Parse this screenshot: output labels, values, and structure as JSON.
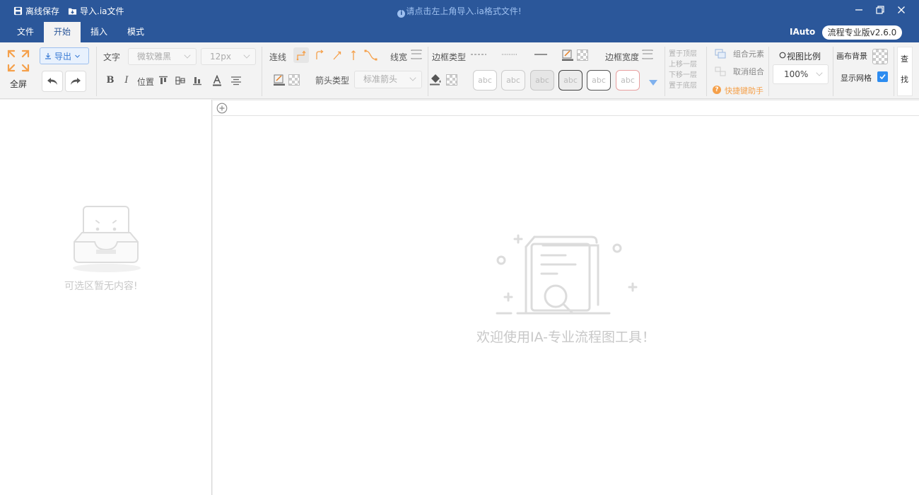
{
  "titlebar": {
    "save_label": "离线保存",
    "import_label": "导入.ia文件",
    "notice": "请点击左上角导入.ia格式文件!"
  },
  "menu": {
    "tabs": [
      {
        "label": "文件"
      },
      {
        "label": "开始",
        "active": true
      },
      {
        "label": "插入"
      },
      {
        "label": "模式"
      }
    ],
    "brand": "IAuto",
    "version": "流程专业版v2.6.0"
  },
  "ribbon": {
    "fullscreen_label": "全屏",
    "export_label": "导出",
    "text_label": "文字",
    "font_family": "微软雅黑",
    "font_size": "12px",
    "position_label": "位置",
    "line_label": "连线",
    "line_width_label": "线宽",
    "arrow_type_label": "箭头类型",
    "arrow_type_value": "标准箭头",
    "border_type_label": "边框类型",
    "border_width_label": "边框宽度",
    "style_samples": [
      "abc",
      "abc",
      "abc",
      "abc",
      "abc",
      "abc"
    ],
    "layer": {
      "to_top": "置于顶层",
      "up": "上移一层",
      "down": "下移一层",
      "to_bottom": "置于底层"
    },
    "group_label": "组合元素",
    "ungroup_label": "取消组合",
    "shortcut_label": "快捷键助手",
    "view_ratio_label": "视图比例",
    "zoom_value": "100%",
    "canvas_bg_label": "画布背景",
    "show_grid_label": "显示网格",
    "show_grid_checked": true,
    "find_label_1": "查",
    "find_label_2": "找"
  },
  "left_panel": {
    "empty_text": "可选区暂无内容!"
  },
  "canvas": {
    "welcome_text": "欢迎使用IA-专业流程图工具！"
  },
  "colors": {
    "brand_blue": "#2b579a",
    "accent_orange": "#f5a04a",
    "checkbox_blue": "#2d8cf0"
  }
}
